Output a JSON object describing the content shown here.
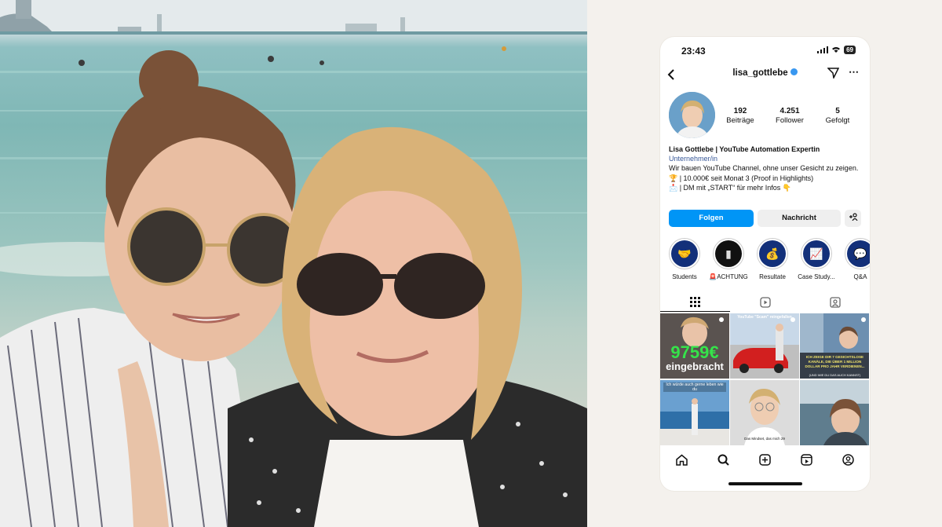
{
  "status_bar": {
    "time": "23:43",
    "battery": "69"
  },
  "header": {
    "username": "lisa_gottlebe",
    "verified": true
  },
  "profile": {
    "stats": [
      {
        "value": "192",
        "label": "Beiträge"
      },
      {
        "value": "4.251",
        "label": "Follower"
      },
      {
        "value": "5",
        "label": "Gefolgt"
      }
    ],
    "bio": {
      "name": "Lisa Gottlebe | YouTube Automation Expertin",
      "category": "Unternehmer/in",
      "line1": "Wir bauen YouTube Channel, ohne unser Gesicht zu zeigen.",
      "line2": "🏆 | 10.000€ seit Monat 3 (Proof in Highlights)",
      "line3": "📩 | DM mit „START“ für mehr Infos 👇"
    }
  },
  "actions": {
    "follow_label": "Folgen",
    "message_label": "Nachricht",
    "add_label": "+👤"
  },
  "highlights": [
    {
      "label": "Students",
      "icon": "handshake-icon"
    },
    {
      "label": "🚨ACHTUNG",
      "icon": "phone-icon"
    },
    {
      "label": "Resultate",
      "icon": "money-icon"
    },
    {
      "label": "Case Study...",
      "icon": "chart-icon"
    },
    {
      "label": "Q&A",
      "icon": "question-icon"
    }
  ],
  "grid_posts": {
    "post1": {
      "big": "9759€",
      "sub": "eingebracht"
    },
    "post2": {
      "caption": "YouTube \"Scam\" reingefallen"
    },
    "post3": {
      "caption": "ICH ZEIGE DIR 7 GESICHTSLOSE KANÄLE, DIE ÜBER 1 MILLION DOLLAR PRO JAHR VERDIENEN...",
      "sub": "(UND WIE DU DAS AUCH KANNST)"
    },
    "post4": {
      "caption": "Ich würde auch gerne leben wie du"
    },
    "post5": {
      "caption": "Das Mindset, das mich 29"
    },
    "post6": {
      "caption": ""
    }
  },
  "colors": {
    "accent": "#0095f6",
    "highlight_bg": "#13307a",
    "panel_bg": "#f4f1ed"
  }
}
